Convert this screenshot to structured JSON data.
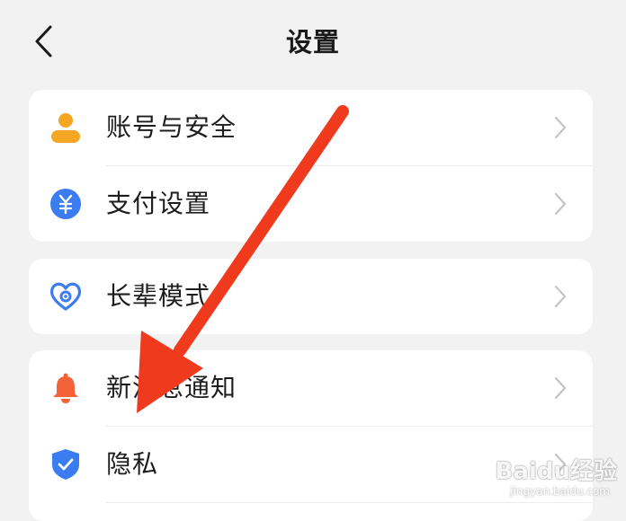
{
  "header": {
    "title": "设置",
    "back_icon": "chevron-left-icon"
  },
  "groups": [
    {
      "items": [
        {
          "label": "账号与安全",
          "icon": "account-person-icon",
          "icon_color": "#f5a623"
        },
        {
          "label": "支付设置",
          "icon": "yuan-payment-icon",
          "icon_color": "#3b7cf0"
        }
      ]
    },
    {
      "items": [
        {
          "label": "长辈模式",
          "icon": "elder-heart-icon",
          "icon_color": "#3b7cf0"
        }
      ]
    },
    {
      "items": [
        {
          "label": "新消息通知",
          "icon": "bell-icon",
          "icon_color": "#f4623a"
        },
        {
          "label": "隐私",
          "icon": "shield-check-icon",
          "icon_color": "#3b7cf0"
        }
      ]
    }
  ],
  "annotation": {
    "arrow_color": "#f03a1e"
  },
  "watermark": {
    "text": "Baidu经验",
    "sub": "jingyan.baidu.com"
  }
}
